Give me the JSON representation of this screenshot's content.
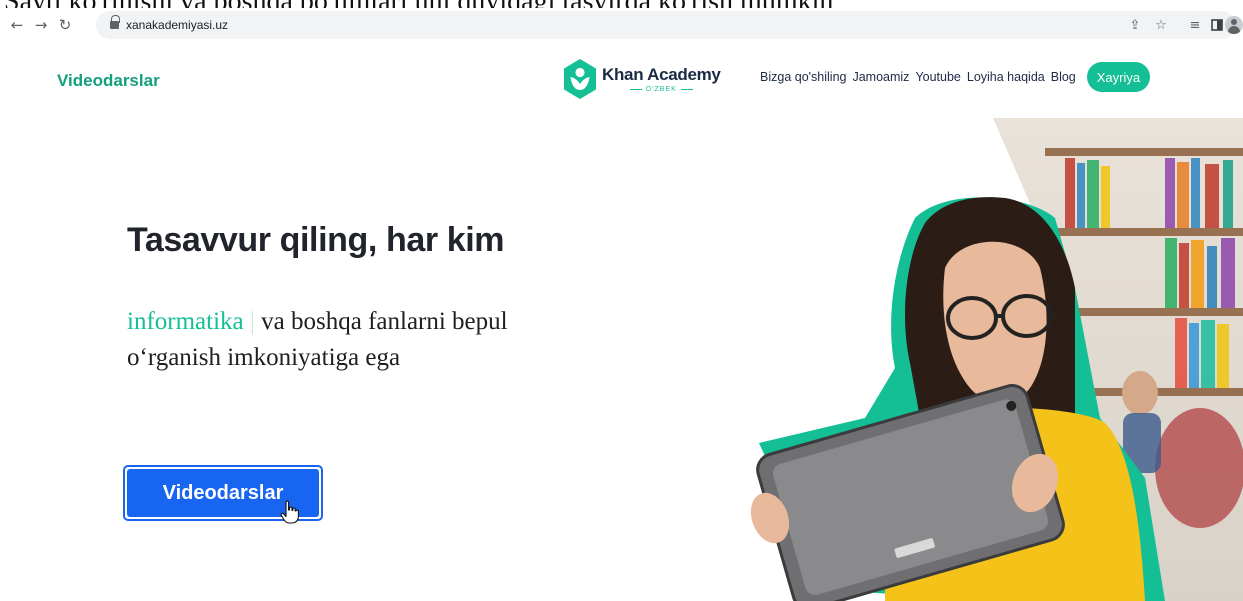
{
  "top_crop_text": "Sayti ko'rinishi va boshqa bo'limlari uni quyidagi tasvirda ko'rish mumkin",
  "browser": {
    "url": "xanakademiyasi.uz",
    "icons": [
      "back-arrow-icon",
      "forward-arrow-icon",
      "reload-icon",
      "lock-icon",
      "share-icon",
      "bookmark-star-icon",
      "reading-list-icon",
      "side-panel-icon",
      "profile-icon"
    ]
  },
  "header": {
    "brand_link": "Videodarslar",
    "logo": {
      "name": "Khan Academy",
      "subtitle": "O'ZBEK"
    },
    "nav": [
      "Bizga qo'shiling",
      "Jamoamiz",
      "Youtube",
      "Loyiha haqida",
      "Blog"
    ],
    "donate_label": "Xayriya"
  },
  "hero": {
    "title": "Tasavvur qiling, har kim",
    "rotating_word": "informatika",
    "caret": "|",
    "subtitle_rest": " va boshqa fanlarni bepul o‘rganish imkoniyatiga ega",
    "cta_label": "Videodarslar"
  },
  "colors": {
    "brand_green": "#14bf96",
    "brand_link_green": "#14a07e",
    "cta_blue": "#1865f2",
    "navy": "#1b2a44"
  }
}
